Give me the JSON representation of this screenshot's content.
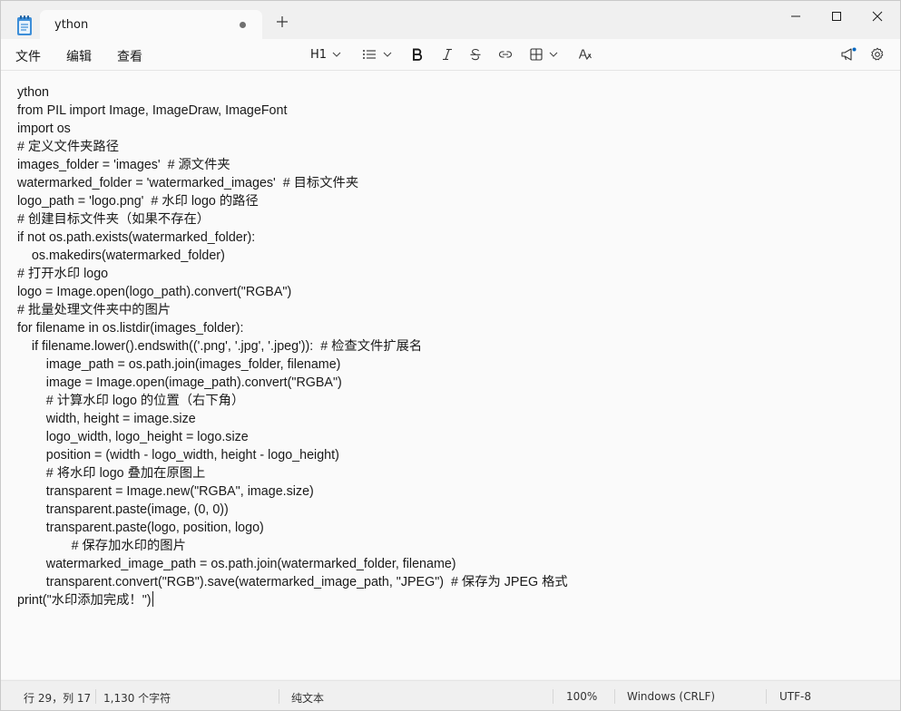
{
  "tab": {
    "title": "ython"
  },
  "menu": {
    "file": "文件",
    "edit": "编辑",
    "view": "查看"
  },
  "toolbar": {
    "heading": "H1"
  },
  "editor": {
    "lines": [
      "ython",
      "from PIL import Image, ImageDraw, ImageFont",
      "import os",
      "# 定义文件夹路径",
      "images_folder = 'images'  # 源文件夹",
      "watermarked_folder = 'watermarked_images'  # 目标文件夹",
      "logo_path = 'logo.png'  # 水印 logo 的路径",
      "# 创建目标文件夹（如果不存在）",
      "if not os.path.exists(watermarked_folder):",
      "    os.makedirs(watermarked_folder)",
      "# 打开水印 logo",
      "logo = Image.open(logo_path).convert(\"RGBA\")",
      "# 批量处理文件夹中的图片",
      "for filename in os.listdir(images_folder):",
      "    if filename.lower().endswith(('.png', '.jpg', '.jpeg')):  # 检查文件扩展名",
      "        image_path = os.path.join(images_folder, filename)",
      "        image = Image.open(image_path).convert(\"RGBA\")",
      "        # 计算水印 logo 的位置（右下角）",
      "        width, height = image.size",
      "        logo_width, logo_height = logo.size",
      "        position = (width - logo_width, height - logo_height)",
      "        # 将水印 logo 叠加在原图上",
      "        transparent = Image.new(\"RGBA\", image.size)",
      "        transparent.paste(image, (0, 0))",
      "        transparent.paste(logo, position, logo)",
      "               # 保存加水印的图片",
      "        watermarked_image_path = os.path.join(watermarked_folder, filename)",
      "        transparent.convert(\"RGB\").save(watermarked_image_path, \"JPEG\")  # 保存为 JPEG 格式",
      "print(\"水印添加完成！\")"
    ]
  },
  "status": {
    "cursor": "行 29，列 17",
    "chars": "1,130 个字符",
    "format": "纯文本",
    "zoom": "100%",
    "line_ending": "Windows (CRLF)",
    "encoding": "UTF-8"
  },
  "colors": {
    "accent": "#0067c0",
    "background": "#fafafa",
    "chrome": "#f0f0f0"
  }
}
